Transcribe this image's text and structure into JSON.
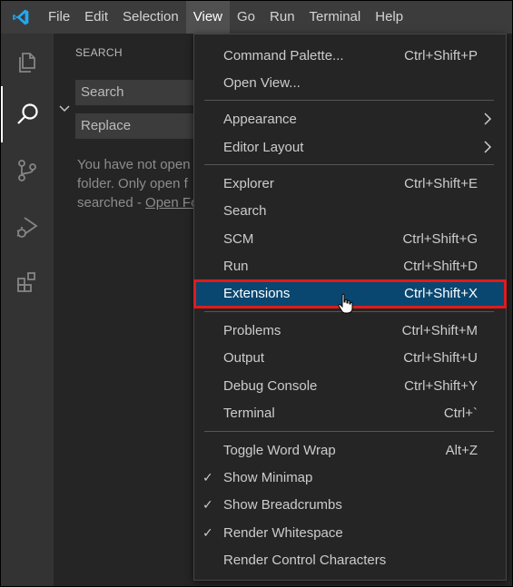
{
  "menubar": {
    "items": [
      "File",
      "Edit",
      "Selection",
      "View",
      "Go",
      "Run",
      "Terminal",
      "Help"
    ],
    "active": "View"
  },
  "sidebar": {
    "title": "SEARCH",
    "search_placeholder": "Search",
    "replace_placeholder": "Replace",
    "message_line1": "You have not open",
    "message_line2": "folder. Only open f",
    "message_line3_prefix": "searched - ",
    "message_link": "Open Fo"
  },
  "view_menu": {
    "groups": [
      [
        {
          "label": "Command Palette...",
          "shortcut": "Ctrl+Shift+P"
        },
        {
          "label": "Open View...",
          "shortcut": ""
        }
      ],
      [
        {
          "label": "Appearance",
          "submenu": true
        },
        {
          "label": "Editor Layout",
          "submenu": true
        }
      ],
      [
        {
          "label": "Explorer",
          "shortcut": "Ctrl+Shift+E"
        },
        {
          "label": "Search",
          "shortcut": ""
        },
        {
          "label": "SCM",
          "shortcut": "Ctrl+Shift+G"
        },
        {
          "label": "Run",
          "shortcut": "Ctrl+Shift+D"
        },
        {
          "label": "Extensions",
          "shortcut": "Ctrl+Shift+X",
          "highlighted": true
        }
      ],
      [
        {
          "label": "Problems",
          "shortcut": "Ctrl+Shift+M"
        },
        {
          "label": "Output",
          "shortcut": "Ctrl+Shift+U"
        },
        {
          "label": "Debug Console",
          "shortcut": "Ctrl+Shift+Y"
        },
        {
          "label": "Terminal",
          "shortcut": "Ctrl+`"
        }
      ],
      [
        {
          "label": "Toggle Word Wrap",
          "shortcut": "Alt+Z"
        },
        {
          "label": "Show Minimap",
          "checked": true
        },
        {
          "label": "Show Breadcrumbs",
          "checked": true
        },
        {
          "label": "Render Whitespace",
          "checked": true
        },
        {
          "label": "Render Control Characters"
        }
      ]
    ]
  },
  "colors": {
    "highlight_bg": "#094771",
    "highlight_border": "#e01b1b",
    "accent": "#0078d4"
  }
}
